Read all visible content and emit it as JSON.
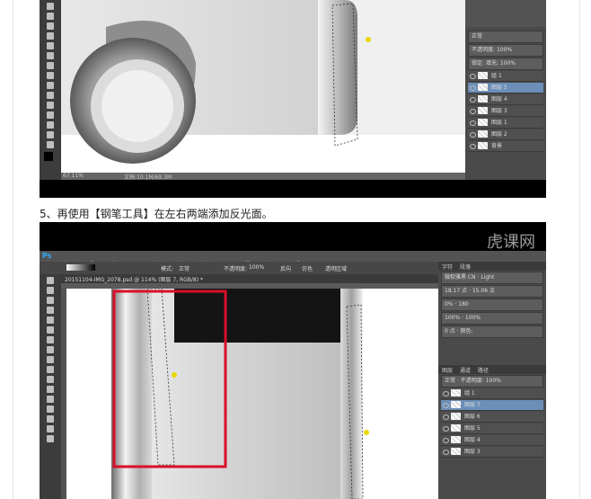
{
  "caption": "5、再使用【钢笔工具】在左右两端添加反光面。",
  "shot1": {
    "status_zoom": "67.11%",
    "status_doc": "文档:10.1M/69.3M",
    "panel_rows": [
      "正常",
      "不透明度:",
      "锁定:",
      "填充:"
    ],
    "panel_values": [
      "100%",
      "100%"
    ],
    "layers": [
      {
        "name": "组 1"
      },
      {
        "name": "图层 5",
        "selected": true
      },
      {
        "name": "图层 4"
      },
      {
        "name": "图层 3"
      },
      {
        "name": "图层 1"
      },
      {
        "name": "图层 2"
      },
      {
        "name": "背景"
      }
    ]
  },
  "shot2": {
    "app_icon": "Ps",
    "menu": [
      "文件(F)",
      "编辑(E)",
      "图像(I)",
      "图层(L)",
      "文字(Y)",
      "选择(S)",
      "滤镜(T)",
      "3D(D)",
      "视图(V)",
      "窗口(W)",
      "帮助(H)"
    ],
    "options": {
      "mode_label": "模式:",
      "mode_value": "正常",
      "opacity_label": "不透明度:",
      "opacity_value": "100%",
      "reverse": "反向",
      "dither": "仿色",
      "transparency": "透明区域"
    },
    "doc_tab": "20151104-IMG_2078.psd @ 114% (图层 7, RGB/8) *",
    "watermark": "虎课网",
    "char_panel": {
      "tabs": [
        "字符",
        "段落"
      ],
      "font": "微软雅黑 CN",
      "style": "Light",
      "size": "18.17 点",
      "leading": "15.06 点",
      "tracking": "180",
      "percent1": "100%",
      "percent2": "100%",
      "baseline": "0 点",
      "color_label": "颜色:",
      "zero_pct": "0%"
    },
    "layers_tabs": [
      "图层",
      "通道",
      "路径"
    ],
    "blend_mode": "正常",
    "opacity_label": "不透明度:",
    "opacity_value": "100%",
    "layers": [
      {
        "name": "组 1"
      },
      {
        "name": "图层 7",
        "selected": true
      },
      {
        "name": "图层 6"
      },
      {
        "name": "图层 5"
      },
      {
        "name": "图层 4"
      },
      {
        "name": "图层 3"
      }
    ]
  }
}
